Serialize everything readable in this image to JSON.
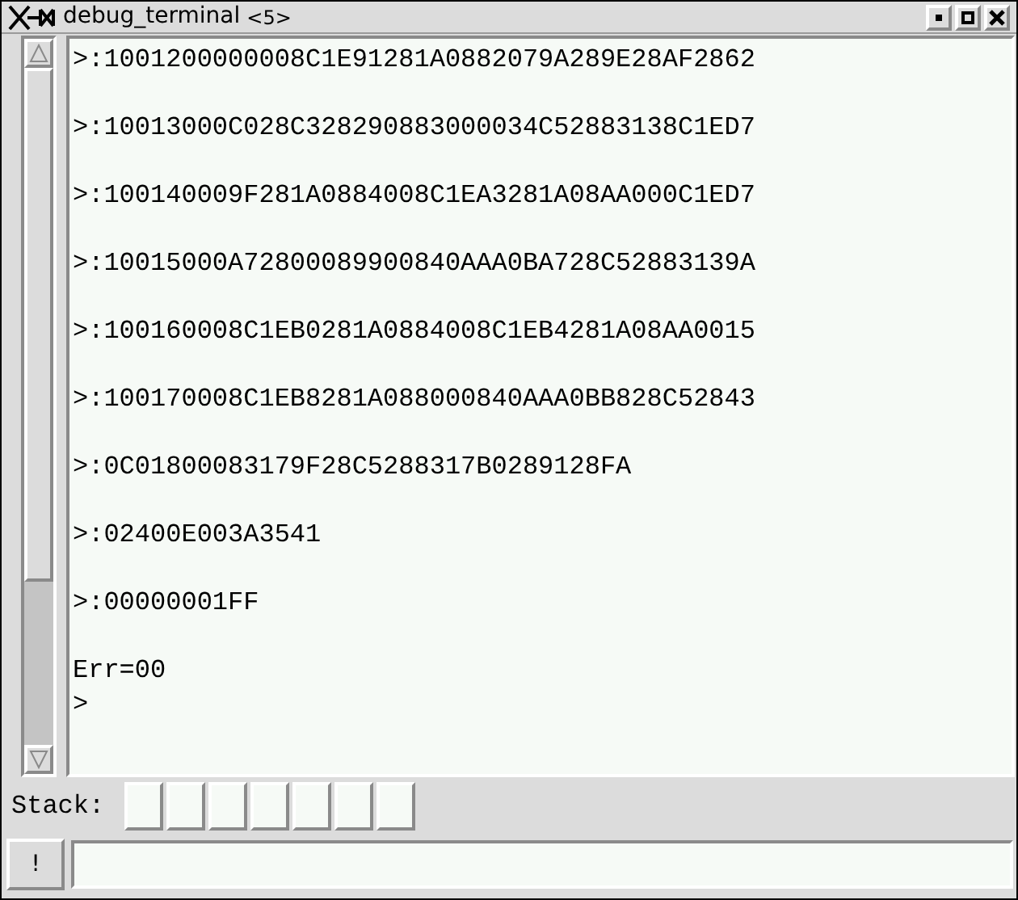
{
  "window": {
    "title": "debug_terminal",
    "instance": "<5>"
  },
  "terminal": {
    "lines": [
      {
        "kind": "response",
        "text": ">:1001200000008C1E91281A0882079A289E28AF2862"
      },
      {
        "kind": "response",
        "text": ">:10013000C028C328290883000034C52883138C1ED7"
      },
      {
        "kind": "response",
        "text": ">:100140009F281A0884008C1EA3281A08AA000C1ED7"
      },
      {
        "kind": "response",
        "text": ">:10015000A72800089900840AAA0BA728C52883139A"
      },
      {
        "kind": "response",
        "text": ">:100160008C1EB0281A0884008C1EB4281A08AA0015"
      },
      {
        "kind": "response",
        "text": ">:100170008C1EB8281A088000840AAA0BB828C52843"
      },
      {
        "kind": "response",
        "text": ">:0C01800083179F28C5288317B0289128FA"
      },
      {
        "kind": "response",
        "text": ">:02400E003A3541"
      },
      {
        "kind": "response",
        "text": ">:00000001FF"
      },
      {
        "kind": "status",
        "text": "Err=00"
      },
      {
        "kind": "prompt",
        "text": ">"
      }
    ]
  },
  "stack": {
    "label": "Stack:"
  },
  "command": {
    "button": "!"
  }
}
